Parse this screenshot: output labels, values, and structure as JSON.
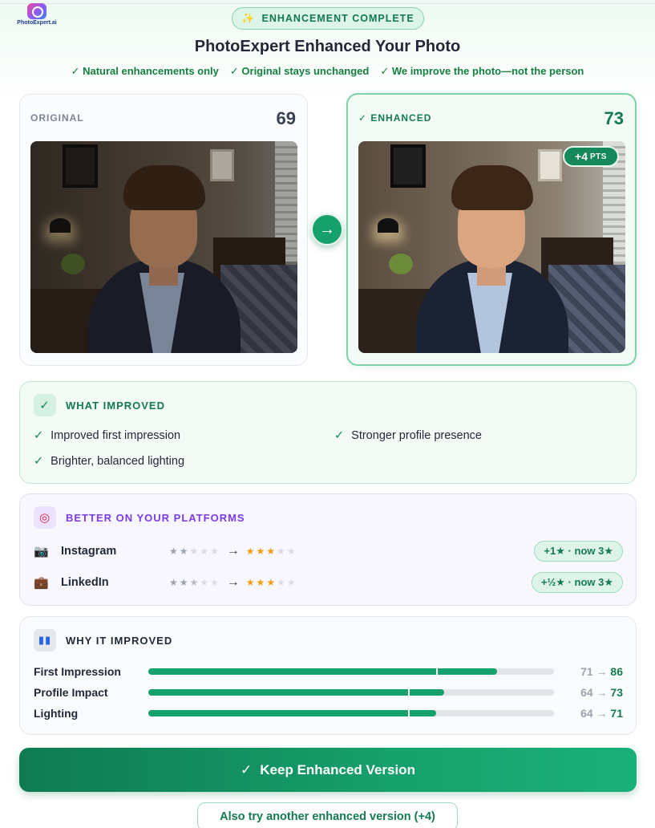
{
  "logo": {
    "text": "PhotoExpert.ai"
  },
  "banner": {
    "status": "ENHANCEMENT COMPLETE",
    "title": "PhotoExpert Enhanced Your Photo"
  },
  "assurances": [
    "✓ Natural enhancements only",
    "✓ Original stays unchanged",
    "✓ We improve the photo—not the person"
  ],
  "original": {
    "label": "ORIGINAL",
    "score": "69"
  },
  "enhanced": {
    "label": "✓ ENHANCED",
    "score": "73",
    "delta_main": "+4",
    "delta_unit": "PTS"
  },
  "improved": {
    "heading": "WHAT IMPROVED",
    "items": [
      "Improved first impression",
      "Stronger profile presence",
      "Brighter, balanced lighting"
    ]
  },
  "platforms": {
    "heading": "BETTER ON YOUR PLATFORMS",
    "rows": [
      {
        "name": "Instagram",
        "icon": "camera-icon",
        "from_stars": 2,
        "to_stars": 3,
        "badge": "+1★ · now 3★"
      },
      {
        "name": "LinkedIn",
        "icon": "briefcase-icon",
        "from_stars": 2.5,
        "to_stars": 3,
        "badge": "+½★ · now 3★"
      }
    ]
  },
  "why": {
    "heading": "WHY IT IMPROVED",
    "rows": [
      {
        "name": "First Impression",
        "from": "71",
        "to": "86",
        "from_pct": 71,
        "to_pct": 86
      },
      {
        "name": "Profile Impact",
        "from": "64",
        "to": "73",
        "from_pct": 64,
        "to_pct": 73
      },
      {
        "name": "Lighting",
        "from": "64",
        "to": "71",
        "from_pct": 64,
        "to_pct": 71
      }
    ]
  },
  "actions": {
    "keep": "Keep Enhanced Version",
    "try": "Also try another enhanced version (+4)"
  },
  "colors": {
    "accent": "#16a06b",
    "accent_dark": "#157a50",
    "purple": "#7c3aed",
    "star": "#f59e0b"
  }
}
